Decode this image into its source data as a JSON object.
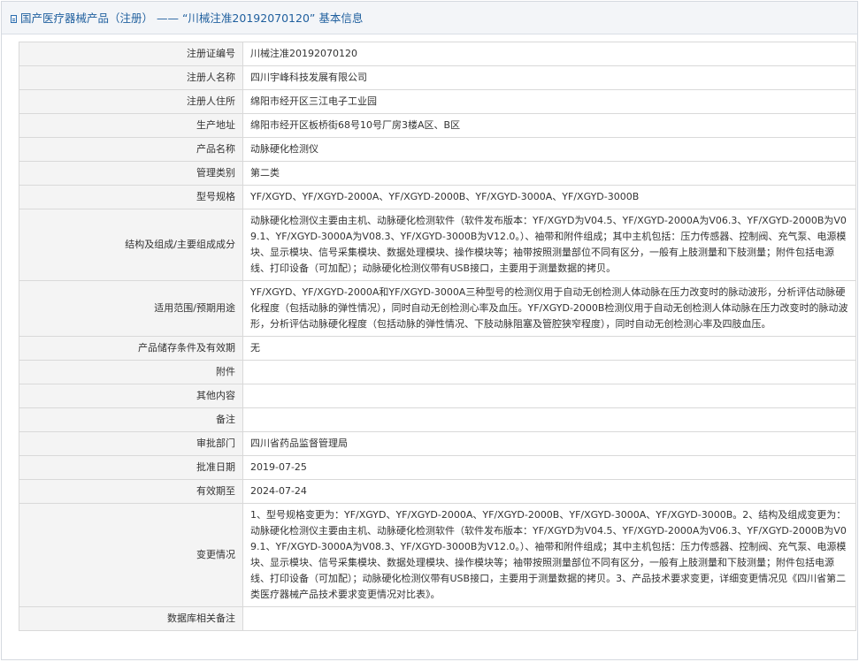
{
  "header": {
    "title": "国产医疗器械产品（注册） —— “川械注准20192070120” 基本信息",
    "icon": "document-icon"
  },
  "rows": [
    {
      "label": "注册证编号",
      "value": "川械注准20192070120"
    },
    {
      "label": "注册人名称",
      "value": "四川宇峰科技发展有限公司"
    },
    {
      "label": "注册人住所",
      "value": "绵阳市经开区三江电子工业园"
    },
    {
      "label": "生产地址",
      "value": "绵阳市经开区板桥街68号10号厂房3楼A区、B区"
    },
    {
      "label": "产品名称",
      "value": "动脉硬化检测仪"
    },
    {
      "label": "管理类别",
      "value": "第二类"
    },
    {
      "label": "型号规格",
      "value": "YF/XGYD、YF/XGYD-2000A、YF/XGYD-2000B、YF/XGYD-3000A、YF/XGYD-3000B"
    },
    {
      "label": "结构及组成/主要组成成分",
      "value": "动脉硬化检测仪主要由主机、动脉硬化检测软件（软件发布版本：YF/XGYD为V04.5、YF/XGYD-2000A为V06.3、YF/XGYD-2000B为V09.1、YF/XGYD-3000A为V08.3、YF/XGYD-3000B为V12.0。）、袖带和附件组成；其中主机包括：压力传感器、控制阀、充气泵、电源模块、显示模块、信号采集模块、数据处理模块、操作模块等；袖带按照测量部位不同有区分，一般有上肢测量和下肢测量；附件包括电源线、打印设备（可加配）；动脉硬化检测仪带有USB接口，主要用于测量数据的拷贝。"
    },
    {
      "label": "适用范围/预期用途",
      "value": "YF/XGYD、YF/XGYD-2000A和YF/XGYD-3000A三种型号的检测仪用于自动无创检测人体动脉在压力改变时的脉动波形，分析评估动脉硬化程度（包括动脉的弹性情况），同时自动无创检测心率及血压。YF/XGYD-2000B检测仪用于自动无创检测人体动脉在压力改变时的脉动波形，分析评估动脉硬化程度（包括动脉的弹性情况、下肢动脉阻塞及管腔狭窄程度），同时自动无创检测心率及四肢血压。"
    },
    {
      "label": "产品储存条件及有效期",
      "value": "无"
    },
    {
      "label": "附件",
      "value": ""
    },
    {
      "label": "其他内容",
      "value": ""
    },
    {
      "label": "备注",
      "value": ""
    },
    {
      "label": "审批部门",
      "value": "四川省药品监督管理局"
    },
    {
      "label": "批准日期",
      "value": "2019-07-25"
    },
    {
      "label": "有效期至",
      "value": "2024-07-24"
    },
    {
      "label": "变更情况",
      "value": "1、型号规格变更为：YF/XGYD、YF/XGYD-2000A、YF/XGYD-2000B、YF/XGYD-3000A、YF/XGYD-3000B。2、结构及组成变更为：动脉硬化检测仪主要由主机、动脉硬化检测软件（软件发布版本：YF/XGYD为V04.5、YF/XGYD-2000A为V06.3、YF/XGYD-2000B为V09.1、YF/XGYD-3000A为V08.3、YF/XGYD-3000B为V12.0。）、袖带和附件组成；其中主机包括：压力传感器、控制阀、充气泵、电源模块、显示模块、信号采集模块、数据处理模块、操作模块等；袖带按照测量部位不同有区分，一般有上肢测量和下肢测量；附件包括电源线、打印设备（可加配）；动脉硬化检测仪带有USB接口，主要用于测量数据的拷贝。3、产品技术要求变更，详细变更情况见《四川省第二类医疗器械产品技术要求变更情况对比表》。"
    },
    {
      "label": "数据库相关备注",
      "value": ""
    }
  ]
}
